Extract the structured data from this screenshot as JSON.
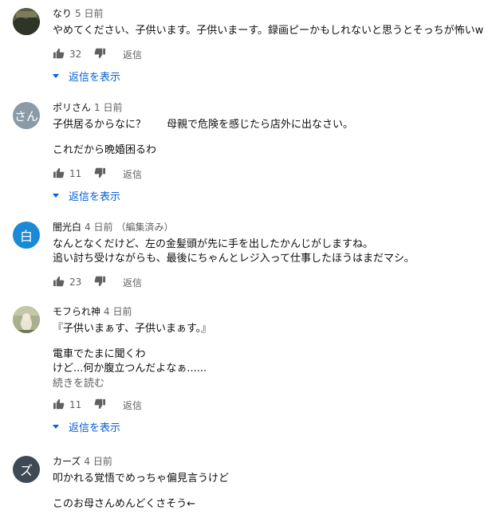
{
  "comments": [
    {
      "author": "なり",
      "time": "5 日前",
      "edited": "",
      "avatar_letter": "",
      "avatar_color": "#4a4a3a",
      "lines": [
        "やめてください、子供います。子供いまーす。録画ピーかもしれないと思うとそっちが怖いw"
      ],
      "likes": "32",
      "reply_label": "返信",
      "show_replies": "返信を表示",
      "read_more": ""
    },
    {
      "author": "ポリさん",
      "time": "1 日前",
      "edited": "",
      "avatar_letter": "さん",
      "avatar_color": "#8a9aa6",
      "lines": [
        "子供居るからなに？　　母親で危険を感じたら店外に出なさい。",
        "",
        "これだから晩婚困るわ"
      ],
      "likes": "11",
      "reply_label": "返信",
      "show_replies": "返信を表示",
      "read_more": ""
    },
    {
      "author": "闇光白",
      "time": "4 日前",
      "edited": "（編集済み）",
      "avatar_letter": "白",
      "avatar_color": "#1a89d6",
      "lines": [
        "なんとなくだけど、左の金髪頭が先に手を出したかんじがしますね。",
        "追い討ち受けながらも、最後にちゃんとレジ入って仕事したほうはまだマシ。"
      ],
      "likes": "23",
      "reply_label": "返信",
      "show_replies": "",
      "read_more": ""
    },
    {
      "author": "モフられ神",
      "time": "4 日前",
      "edited": "",
      "avatar_letter": "",
      "avatar_color": "#9fae8a",
      "lines": [
        "『子供いまぁす、子供いまぁす。』",
        "",
        "電車でたまに聞くわ",
        "けど...何か腹立つんだよなぁ......"
      ],
      "likes": "11",
      "reply_label": "返信",
      "show_replies": "返信を表示",
      "read_more": "続きを読む"
    },
    {
      "author": "カーズ",
      "time": "4 日前",
      "edited": "",
      "avatar_letter": "ズ",
      "avatar_color": "#3d4a55",
      "lines": [
        "叩かれる覚悟でめっちゃ偏見言うけど",
        "",
        "このお母さんめんどくさそう←"
      ],
      "likes": "",
      "reply_label": "",
      "show_replies": "",
      "read_more": ""
    }
  ]
}
